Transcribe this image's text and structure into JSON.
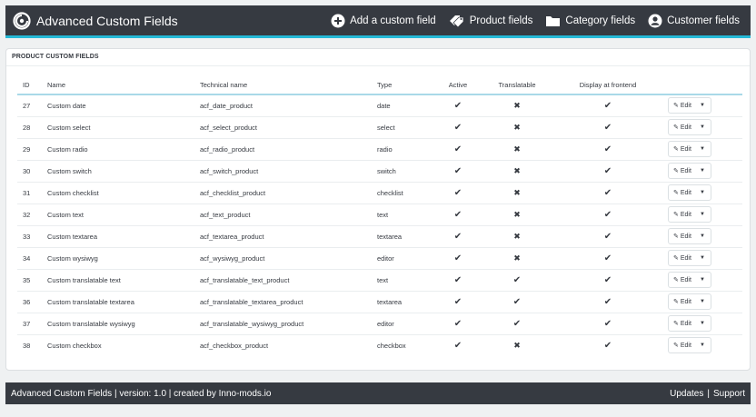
{
  "header": {
    "title": "Advanced Custom Fields",
    "nav": [
      {
        "label": "Add a custom field",
        "icon": "plus-circle-icon"
      },
      {
        "label": "Product fields",
        "icon": "tags-icon"
      },
      {
        "label": "Category fields",
        "icon": "folder-icon"
      },
      {
        "label": "Customer fields",
        "icon": "user-circle-icon"
      }
    ]
  },
  "panel": {
    "heading": "PRODUCT CUSTOM FIELDS",
    "columns": [
      "ID",
      "Name",
      "Technical name",
      "Type",
      "Active",
      "Translatable",
      "Display at frontend"
    ],
    "edit_label": "Edit",
    "rows": [
      {
        "id": "27",
        "name": "Custom date",
        "technical": "acf_date_product",
        "type": "date",
        "active": true,
        "translatable": false,
        "frontend": true
      },
      {
        "id": "28",
        "name": "Custom select",
        "technical": "acf_select_product",
        "type": "select",
        "active": true,
        "translatable": false,
        "frontend": true
      },
      {
        "id": "29",
        "name": "Custom radio",
        "technical": "acf_radio_product",
        "type": "radio",
        "active": true,
        "translatable": false,
        "frontend": true
      },
      {
        "id": "30",
        "name": "Custom switch",
        "technical": "acf_switch_product",
        "type": "switch",
        "active": true,
        "translatable": false,
        "frontend": true
      },
      {
        "id": "31",
        "name": "Custom checklist",
        "technical": "acf_checklist_product",
        "type": "checklist",
        "active": true,
        "translatable": false,
        "frontend": true
      },
      {
        "id": "32",
        "name": "Custom text",
        "technical": "acf_text_product",
        "type": "text",
        "active": true,
        "translatable": false,
        "frontend": true
      },
      {
        "id": "33",
        "name": "Custom textarea",
        "technical": "acf_textarea_product",
        "type": "textarea",
        "active": true,
        "translatable": false,
        "frontend": true
      },
      {
        "id": "34",
        "name": "Custom wysiwyg",
        "technical": "acf_wysiwyg_product",
        "type": "editor",
        "active": true,
        "translatable": false,
        "frontend": true
      },
      {
        "id": "35",
        "name": "Custom translatable text",
        "technical": "acf_translatable_text_product",
        "type": "text",
        "active": true,
        "translatable": true,
        "frontend": true
      },
      {
        "id": "36",
        "name": "Custom translatable textarea",
        "technical": "acf_translatable_textarea_product",
        "type": "textarea",
        "active": true,
        "translatable": true,
        "frontend": true
      },
      {
        "id": "37",
        "name": "Custom translatable wysiwyg",
        "technical": "acf_translatable_wysiwyg_product",
        "type": "editor",
        "active": true,
        "translatable": true,
        "frontend": true
      },
      {
        "id": "38",
        "name": "Custom checkbox",
        "technical": "acf_checkbox_product",
        "type": "checkbox",
        "active": true,
        "translatable": false,
        "frontend": true
      }
    ]
  },
  "footer": {
    "info": "Advanced Custom Fields | version: 1.0 | created by Inno-mods.io",
    "updates": "Updates",
    "support": "Support",
    "separator": "|"
  },
  "colors": {
    "bar": "#363a41",
    "accent": "#25b9d7"
  }
}
